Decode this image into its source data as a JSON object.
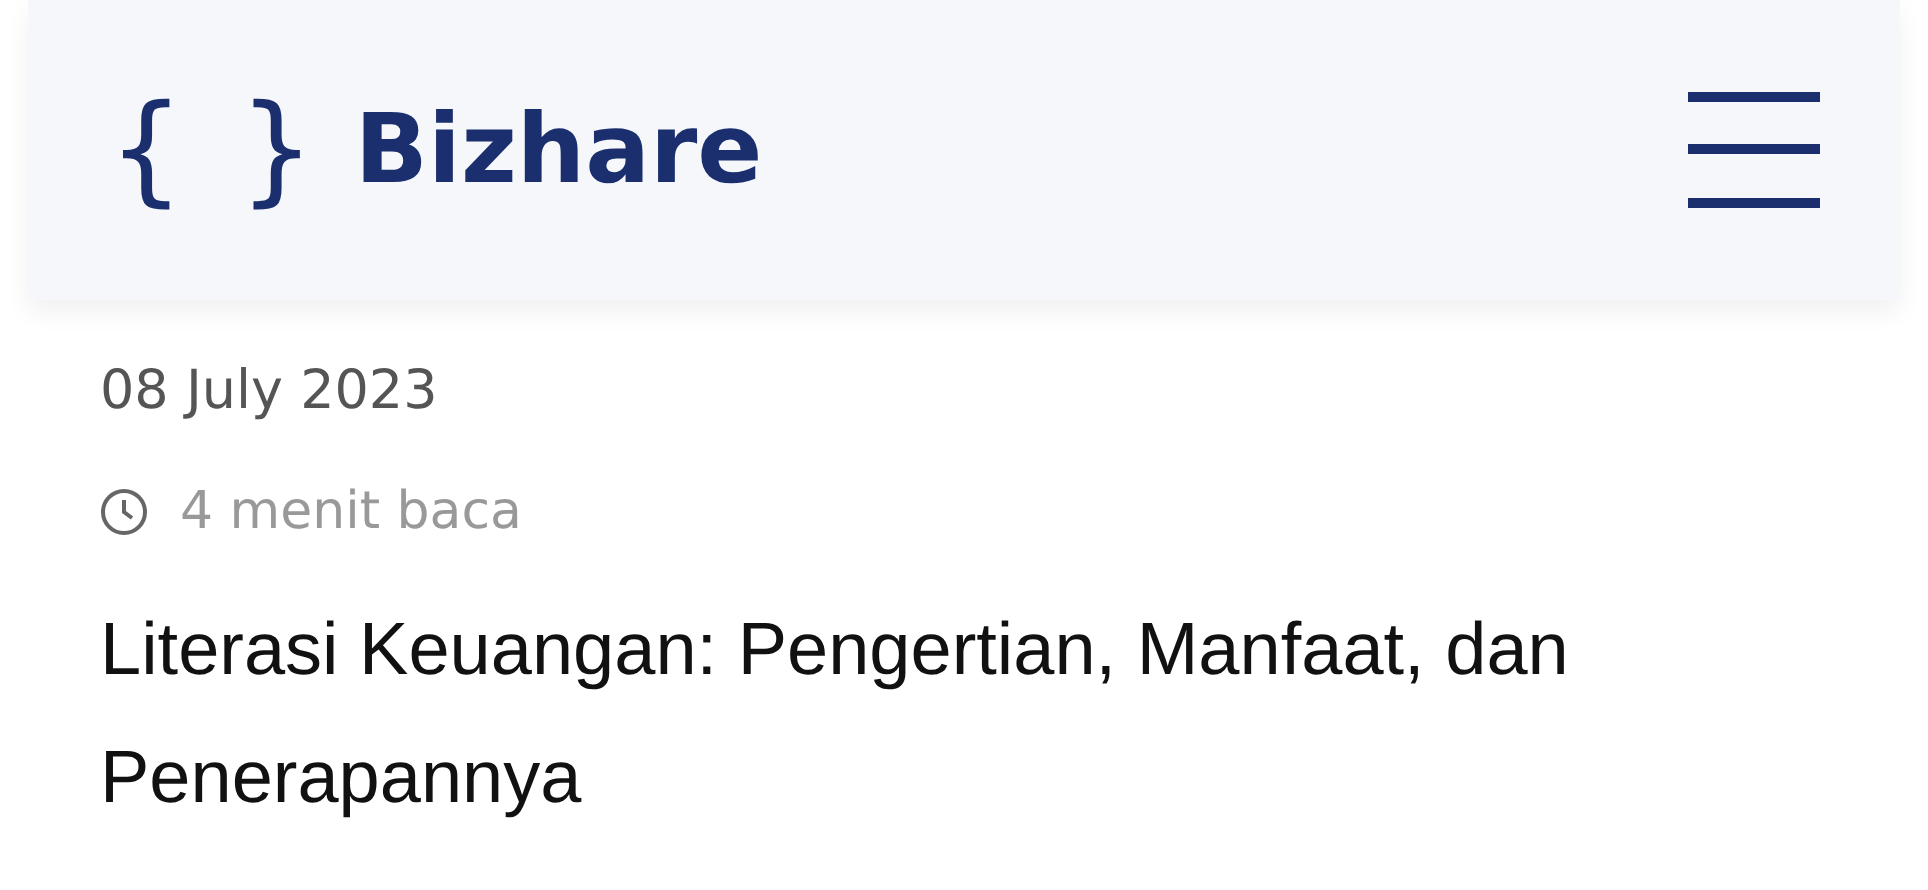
{
  "header": {
    "logo_mark": "{ }",
    "brand": "Bizhare"
  },
  "article": {
    "date": "08 July 2023",
    "read_time": "4 menit baca",
    "title": "Literasi Keuangan: Pengertian, Manfaat, dan Penerapannya"
  }
}
